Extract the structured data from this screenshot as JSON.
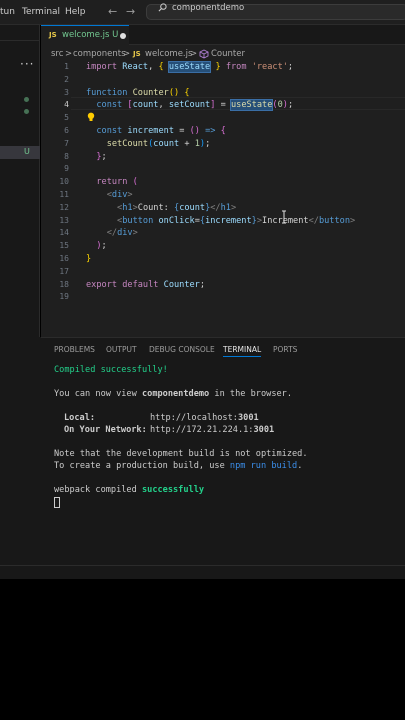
{
  "menu": [
    "tun",
    "Terminal",
    "Help"
  ],
  "search": {
    "text": "componentdemo",
    "icon": "search-icon"
  },
  "activity": {
    "ellipsis": "···",
    "badge": "U"
  },
  "tab": {
    "badge": "JS",
    "name": "welcome.js",
    "status": "U"
  },
  "breadcrumbs": {
    "parts": [
      "src",
      ">",
      "components",
      ">",
      "welcome.js",
      ">",
      "Counter"
    ],
    "badge": "JS"
  },
  "editor": {
    "active_line": 4,
    "lines": [
      {
        "n": "1",
        "code": "import React, { useState } from 'react';"
      },
      {
        "n": "2",
        "code": ""
      },
      {
        "n": "3",
        "code": "function Counter() {"
      },
      {
        "n": "4",
        "code": "  const [count, setCount] = useState(0);"
      },
      {
        "n": "5",
        "code": ""
      },
      {
        "n": "6",
        "code": "  const increment = () => {"
      },
      {
        "n": "7",
        "code": "    setCount(count + 1);"
      },
      {
        "n": "8",
        "code": "  };"
      },
      {
        "n": "9",
        "code": ""
      },
      {
        "n": "10",
        "code": "  return ("
      },
      {
        "n": "11",
        "code": "    <div>"
      },
      {
        "n": "12",
        "code": "      <h1>Count: {count}</h1>"
      },
      {
        "n": "13",
        "code": "      <button onClick={increment}>Increment</button>"
      },
      {
        "n": "14",
        "code": "    </div>"
      },
      {
        "n": "15",
        "code": "  );"
      },
      {
        "n": "16",
        "code": "}"
      },
      {
        "n": "17",
        "code": ""
      },
      {
        "n": "18",
        "code": "export default Counter;"
      },
      {
        "n": "19",
        "code": ""
      }
    ]
  },
  "panel": {
    "tabs": [
      "PROBLEMS",
      "OUTPUT",
      "DEBUG CONSOLE",
      "TERMINAL",
      "PORTS"
    ],
    "active_tab": "TERMINAL"
  },
  "terminal": {
    "compiled": "Compiled successfully!",
    "view_prefix": "You can now view ",
    "app_name": "componentdemo",
    "view_suffix": " in the browser.",
    "local_label": "Local:",
    "local_url_prefix": "http://localhost:",
    "local_port": "3001",
    "network_label": "On Your Network:",
    "network_url_prefix": "http://172.21.224.1:",
    "network_port": "3001",
    "note1": "Note that the development build is not optimized.",
    "note2_prefix": "To create a production build, use ",
    "note2_cmd": "npm run build",
    "note2_suffix": ".",
    "webpack_prefix": "webpack compiled ",
    "webpack_status": "successfully"
  },
  "colors": {
    "accent": "#0078d4",
    "untracked": "#73c991",
    "success": "#23d18b",
    "js_badge": "#e8c94a"
  }
}
